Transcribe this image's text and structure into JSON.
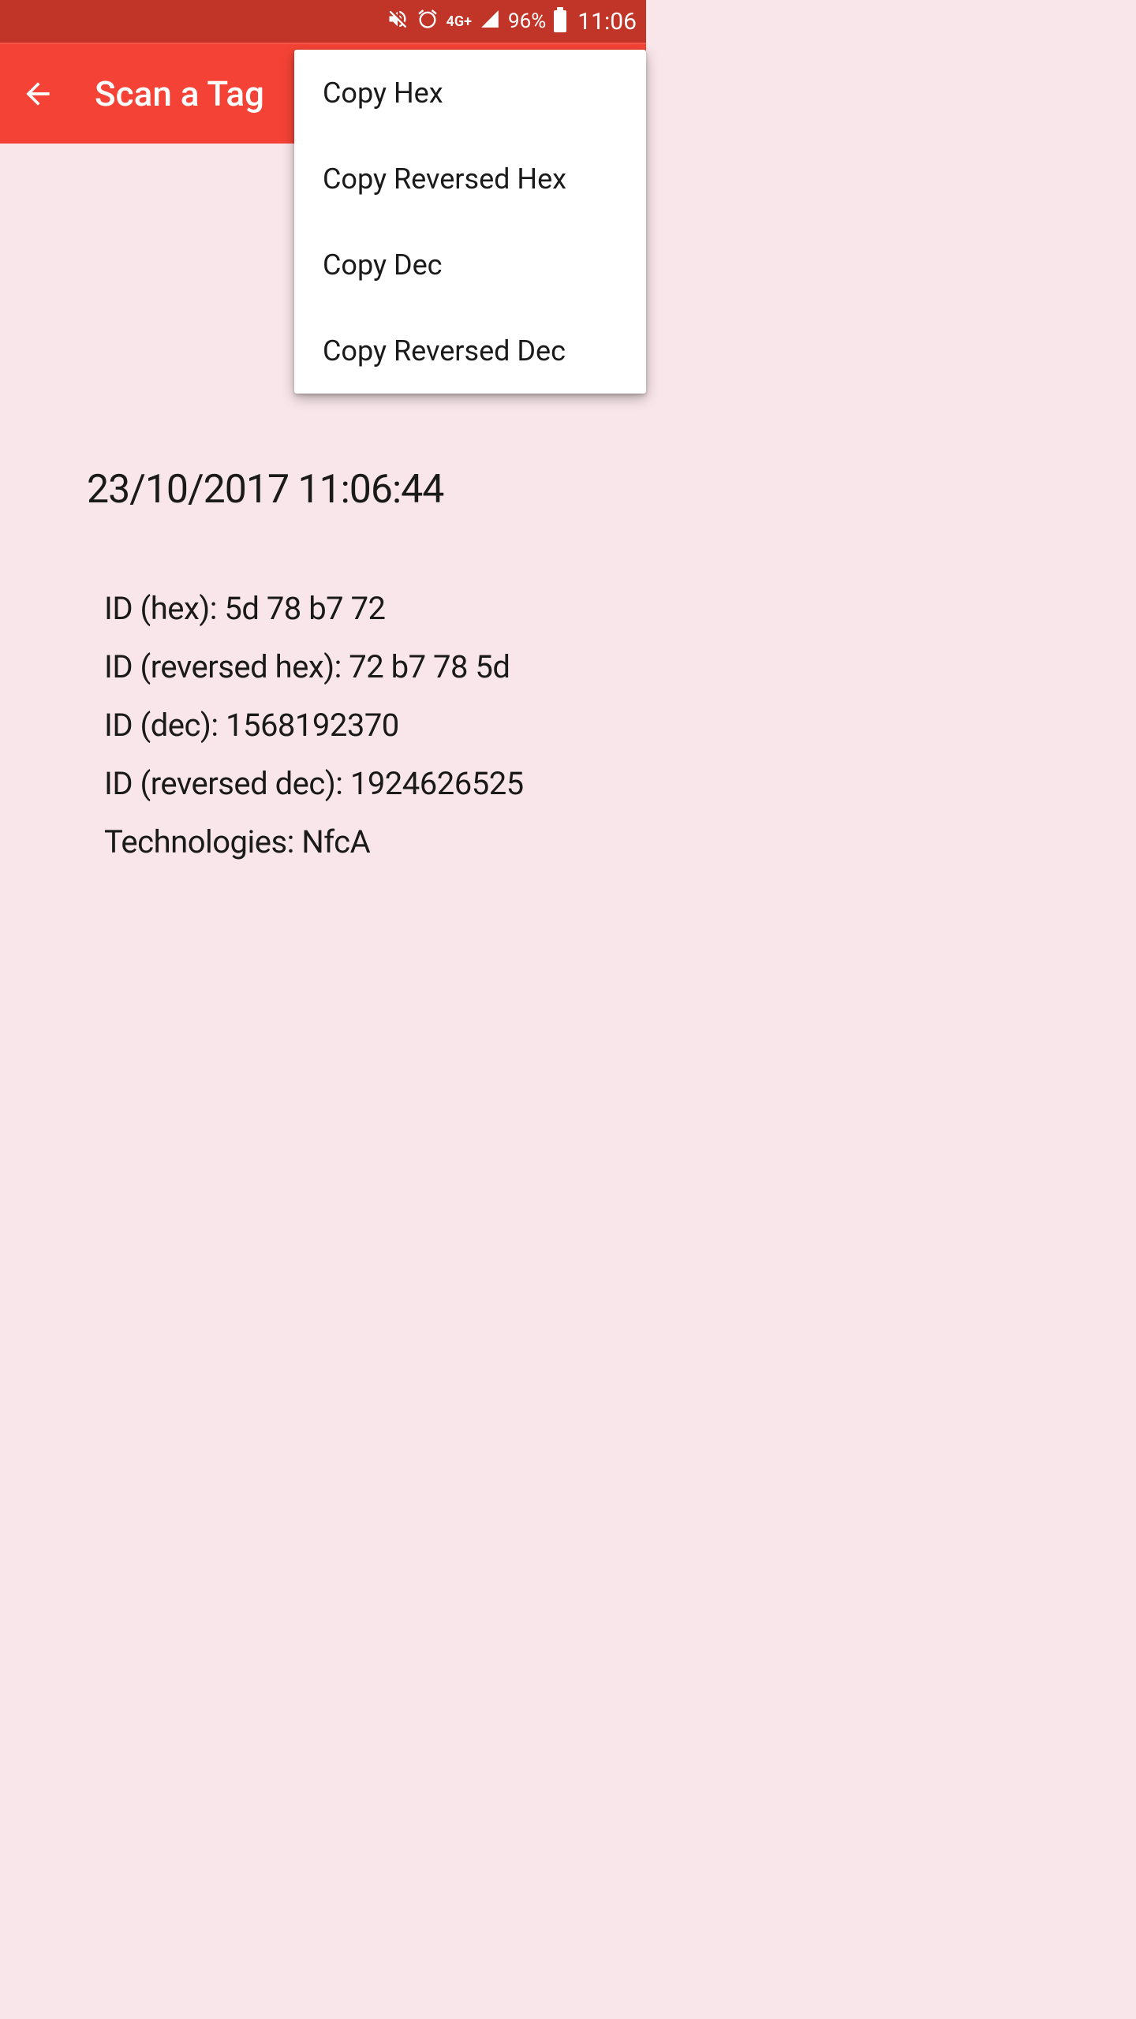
{
  "status": {
    "network": "4G+",
    "battery": "96%",
    "time": "11:06"
  },
  "app_bar": {
    "title": "Scan a Tag"
  },
  "popup_menu": {
    "items": [
      "Copy Hex",
      "Copy Reversed Hex",
      "Copy Dec",
      "Copy Reversed Dec"
    ]
  },
  "content": {
    "timestamp": "23/10/2017  11:06:44",
    "rows": [
      "ID (hex): 5d 78 b7 72",
      "ID (reversed hex): 72 b7 78 5d",
      "ID (dec): 1568192370",
      "ID (reversed dec): 1924626525",
      "Technologies: NfcA"
    ]
  }
}
